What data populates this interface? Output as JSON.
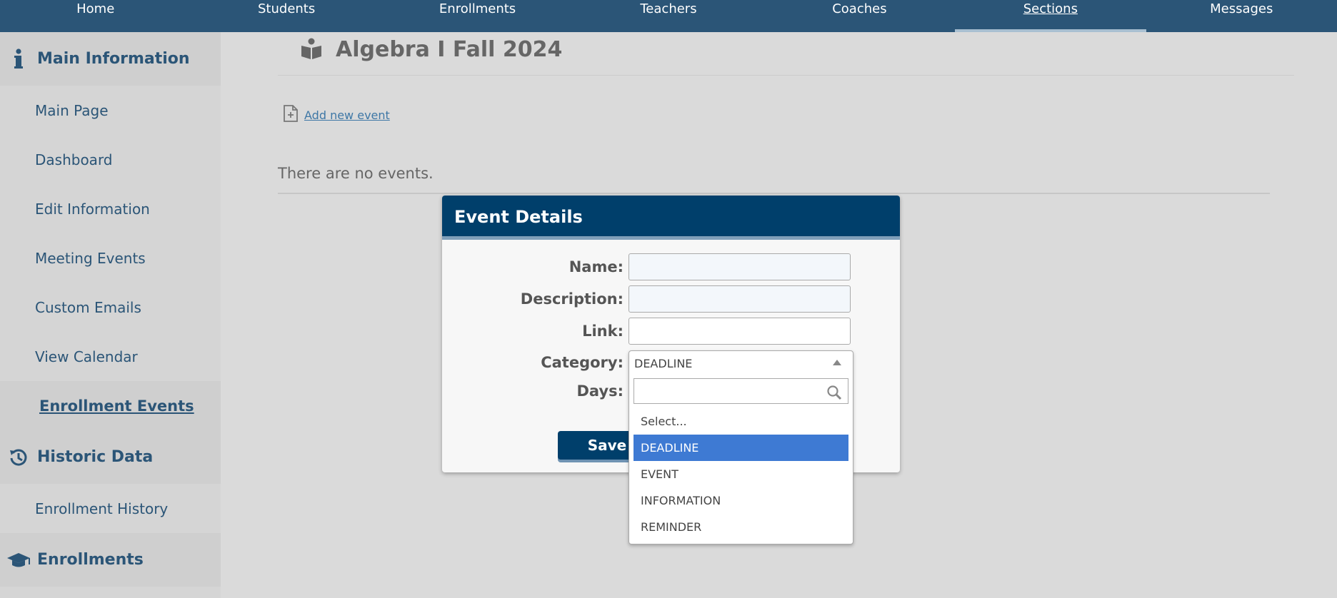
{
  "nav": {
    "items": [
      {
        "label": "Home"
      },
      {
        "label": "Students"
      },
      {
        "label": "Enrollments"
      },
      {
        "label": "Teachers"
      },
      {
        "label": "Coaches"
      },
      {
        "label": "Sections"
      },
      {
        "label": "Messages"
      }
    ],
    "active": "Sections"
  },
  "sidebar": {
    "main_info": {
      "label": "Main Information",
      "icon": "info-icon"
    },
    "main_links": [
      {
        "label": "Main Page"
      },
      {
        "label": "Dashboard"
      },
      {
        "label": "Edit Information"
      },
      {
        "label": "Meeting Events"
      },
      {
        "label": "Custom Emails"
      },
      {
        "label": "View Calendar"
      }
    ],
    "active_link": {
      "label": "Enrollment Events"
    },
    "historic": {
      "label": "Historic Data",
      "icon": "history-icon"
    },
    "historic_links": [
      {
        "label": "Enrollment History"
      }
    ],
    "enrollments": {
      "label": "Enrollments",
      "icon": "graduation-cap-icon"
    }
  },
  "main": {
    "title": "Algebra I Fall 2024",
    "title_icon": "reader-book-icon",
    "add_event_label": "Add new event",
    "add_event_icon": "add-file-icon",
    "empty_text": "There are no events."
  },
  "dialog": {
    "title": "Event Details",
    "labels": {
      "name": "Name:",
      "description": "Description:",
      "link": "Link:",
      "category": "Category:",
      "days": "Days:"
    },
    "values": {
      "name": "",
      "description": "",
      "link": ""
    },
    "save_label": "Save"
  },
  "category_dropdown": {
    "selected": "DEADLINE",
    "search_value": "",
    "options": [
      {
        "label": "Select..."
      },
      {
        "label": "DEADLINE"
      },
      {
        "label": "EVENT"
      },
      {
        "label": "INFORMATION"
      },
      {
        "label": "REMINDER"
      }
    ],
    "highlighted": "DEADLINE"
  },
  "colors": {
    "nav_bg": "#2b5577",
    "dialog_header": "#003f6b",
    "highlight": "#3e7ad3",
    "link": "#3e77a6"
  }
}
